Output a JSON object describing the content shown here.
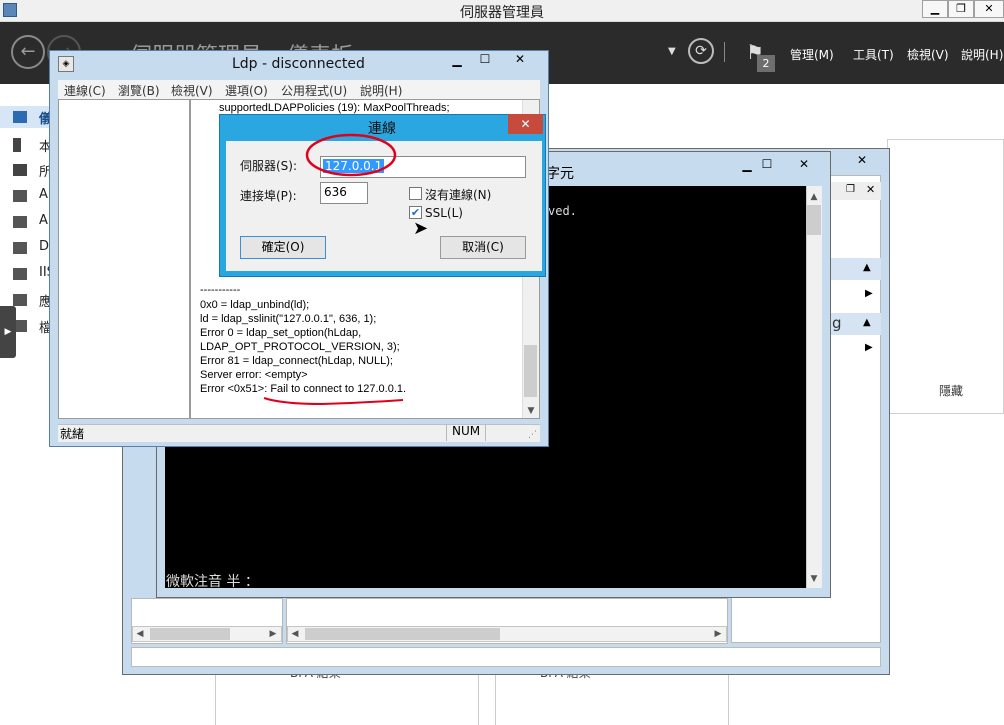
{
  "server_manager": {
    "title": "伺服器管理員",
    "header_title": "伺服器管理員 ▸ 儀表板",
    "menu": [
      "管理(M)",
      "工具(T)",
      "檢視(V)",
      "說明(H)"
    ],
    "notification_count": "2",
    "nav_items": [
      "儀",
      "本",
      "所",
      "A",
      "A",
      "D",
      "IIS",
      "應",
      "檔"
    ]
  },
  "background_panel": {
    "hide_label": "隱藏",
    "tile_label_partial": "g",
    "bottom_labels": [
      "BPA 結果",
      "BPA 結果"
    ]
  },
  "console": {
    "title_partial": "字元",
    "text_line": "ved.",
    "ime_status": "微軟注音 半 ："
  },
  "ldp": {
    "title": "Ldp - disconnected",
    "menu": [
      "連線(C)",
      "瀏覽(B)",
      "檢視(V)",
      "選項(O)",
      "公用程式(U)",
      "說明(H)"
    ],
    "output_top": "supportedLDAPPolicies (19): MaxPoolThreads;",
    "output_lines": [
      "-----------",
      "0x0 = ldap_unbind(ld);",
      "ld = ldap_sslinit(\"127.0.0.1\", 636, 1);",
      "Error 0 = ldap_set_option(hLdap,",
      "LDAP_OPT_PROTOCOL_VERSION, 3);",
      "Error 81 = ldap_connect(hLdap, NULL);",
      "Server error: <empty>",
      "Error <0x51>: Fail to connect to 127.0.0.1."
    ],
    "status_ready": "就緒",
    "status_num": "NUM"
  },
  "connect_dialog": {
    "title": "連線",
    "server_label": "伺服器(S):",
    "server_value": "127.0.0.1",
    "port_label": "連接埠(P):",
    "port_value": "636",
    "connectionless_label": "沒有連線(N)",
    "connectionless_checked": false,
    "ssl_label": "SSL(L)",
    "ssl_checked": true,
    "ok_label": "確定(O)",
    "cancel_label": "取消(C)"
  },
  "colors": {
    "dialog_title": "#2aa6e0",
    "annotation_red": "#e0001a",
    "server_manager_header": "#2b2b2b",
    "selected_text": "#3399ff"
  }
}
